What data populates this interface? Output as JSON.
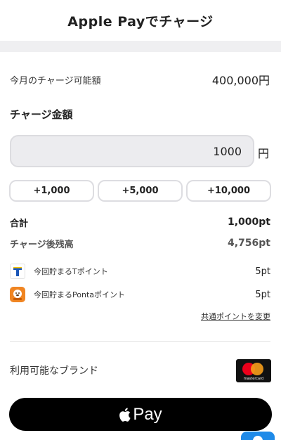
{
  "header": {
    "title": "Apple Payでチャージ"
  },
  "limit": {
    "label": "今月のチャージ可能額",
    "value": "400,000円"
  },
  "charge": {
    "section_title": "チャージ金額",
    "amount_value": "1000",
    "unit": "円",
    "quick_buttons": [
      {
        "label": "+1,000"
      },
      {
        "label": "+5,000"
      },
      {
        "label": "+10,000"
      }
    ]
  },
  "summary": {
    "total_label": "合計",
    "total_value": "1,000pt",
    "balance_label": "チャージ後残高",
    "balance_value": "4,756pt"
  },
  "points": [
    {
      "label": "今回貯まるTポイント",
      "value": "5pt",
      "icon": "t-point-icon"
    },
    {
      "label": "今回貯まるPontaポイント",
      "value": "5pt",
      "icon": "ponta-icon"
    }
  ],
  "change_link": "共通ポイントを変更",
  "brands": {
    "label": "利用可能なブランド",
    "brand_icon": "mastercard-logo",
    "mastercard_text": "mastercard"
  },
  "apple_pay": {
    "label": "Pay",
    "icon": "apple-icon"
  },
  "colors": {
    "band": "#efeff1",
    "button_dark": "#000000",
    "fab": "#1e8ae8"
  }
}
